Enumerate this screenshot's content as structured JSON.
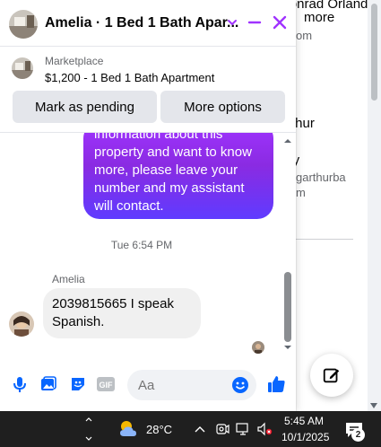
{
  "background_page": {
    "lines": [
      {
        "text": "Conrad Orlando",
        "style": "title"
      },
      {
        "text": "more",
        "style": "title"
      },
      {
        "text": "om",
        "style": "sub"
      },
      {
        "text": "rthur",
        "style": "title"
      },
      {
        "text": "iny",
        "style": "title"
      },
      {
        "text": "garthurba",
        "style": "sub"
      },
      {
        "text": "m",
        "style": "sub"
      }
    ]
  },
  "chat": {
    "title": "Amelia · 1 Bed 1 Bath Apar...",
    "listing": {
      "label": "Marketplace",
      "price_line": "$1,200 - 1 Bed 1 Bath Apartment",
      "mark_pending_label": "Mark as pending",
      "more_options_label": "More options"
    },
    "messages": {
      "outgoing_lines": [
        "information about this",
        "property and want to know",
        "more, please leave your",
        "number and my assistant",
        "will contact."
      ],
      "timestamp": "Tue 6:54 PM",
      "sender_name": "Amelia",
      "incoming_lines": [
        "2039815665 I speak",
        "Spanish."
      ]
    },
    "composer": {
      "placeholder": "Aa"
    }
  },
  "taskbar": {
    "temperature": "28°C",
    "time": "5:45 AM",
    "date": "10/1/2025",
    "notification_count": "2"
  },
  "colors": {
    "accent": "#a033ff",
    "messenger_blue": "#0866ff",
    "taskbar_bg": "#1f1f1f"
  }
}
